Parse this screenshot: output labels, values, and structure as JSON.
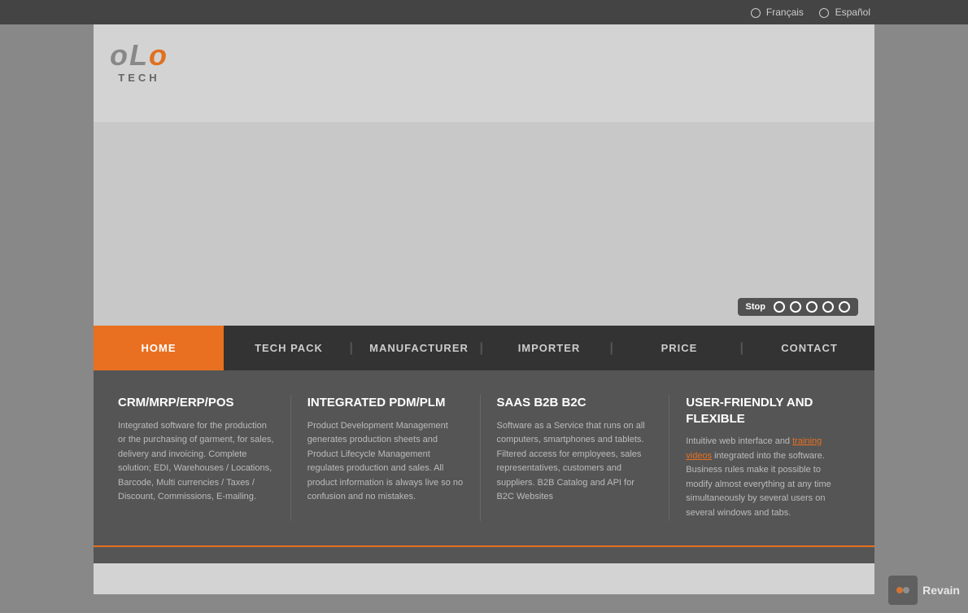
{
  "topbar": {
    "lang_french": "Français",
    "lang_spanish": "Español"
  },
  "logo": {
    "text": "oLo",
    "subtext": "TECH"
  },
  "slideshow": {
    "stop_label": "Stop",
    "dots": [
      {
        "id": 1,
        "active": false
      },
      {
        "id": 2,
        "active": false
      },
      {
        "id": 3,
        "active": false
      },
      {
        "id": 4,
        "active": false
      },
      {
        "id": 5,
        "active": false
      }
    ]
  },
  "nav": {
    "items": [
      {
        "label": "HOME",
        "active": true
      },
      {
        "label": "TECH PACK",
        "active": false
      },
      {
        "label": "MANUFACTURER",
        "active": false
      },
      {
        "label": "IMPORTER",
        "active": false
      },
      {
        "label": "PRICE",
        "active": false
      },
      {
        "label": "CONTACT",
        "active": false
      }
    ]
  },
  "features": [
    {
      "title": "CRM/MRP/ERP/POS",
      "text": "Integrated software for the production or the purchasing of garment, for sales, delivery and invoicing. Complete solution; EDI, Warehouses / Locations, Barcode, Multi currencies / Taxes / Discount, Commissions, E-mailing."
    },
    {
      "title": "INTEGRATED PDM/PLM",
      "text": "Product Development Management generates production sheets and Product Lifecycle Management regulates production and sales. All product information is always live so no confusion and no mistakes."
    },
    {
      "title": "SAAS B2B B2C",
      "text": "Software as a Service that runs on all computers, smartphones and tablets. Filtered access for employees, sales representatives, customers and suppliers. B2B Catalog and API for B2C Websites"
    },
    {
      "title": "USER-FRIENDLY AND FLEXIBLE",
      "text_before_link": "Intuitive web interface and ",
      "link_text": "training videos",
      "text_after_link": " integrated into the software. Business rules make it possible to modify almost everything at any time simultaneously by several users on several windows and tabs."
    }
  ],
  "revain": {
    "label": "Revain"
  }
}
